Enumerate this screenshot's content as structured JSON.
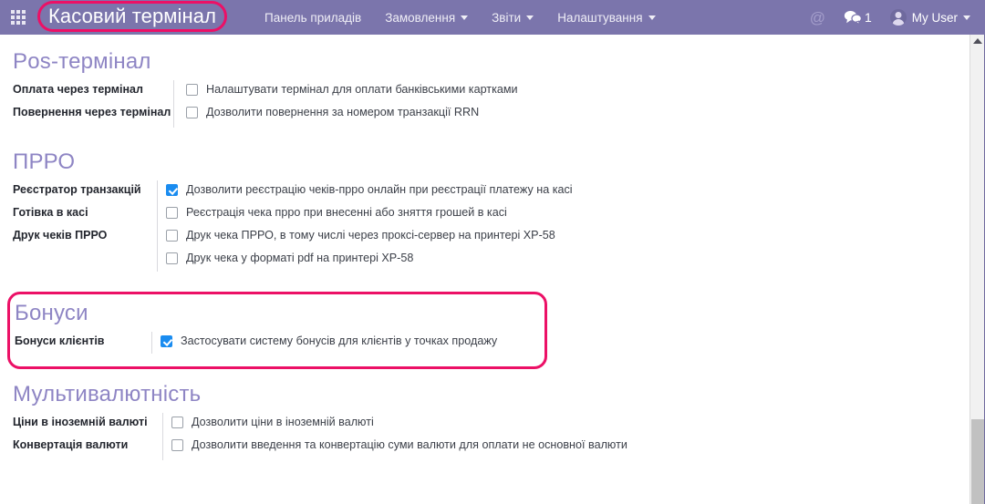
{
  "topbar": {
    "apps_icon": "apps-grid-icon",
    "brand_title": "Касовий термінал",
    "nav_items": [
      {
        "label": "Панель приладів",
        "has_caret": false
      },
      {
        "label": "Замовлення",
        "has_caret": true
      },
      {
        "label": "Звіти",
        "has_caret": true
      },
      {
        "label": "Налаштування",
        "has_caret": true
      }
    ],
    "mention_icon": "@",
    "chat_icon": "chat-bubbles-icon",
    "chat_count": "1",
    "avatar_icon": "user-avatar",
    "username": "My User",
    "user_caret": true
  },
  "highlight_color": "#ec1066",
  "accent_color": "#8e85c4",
  "header_color": "#7b75ac",
  "checkbox_on_color": "#1a8cf0",
  "sections": [
    {
      "id": "pos",
      "title": "Pos-термінал",
      "rows": [
        {
          "label": "Оплата через термінал",
          "checkbox_text": "Налаштувати термінал для оплати банківськими картками",
          "checked": false
        },
        {
          "label": "Повернення через термінал",
          "checkbox_text": "Дозволити повернення за номером транзакції RRN",
          "checked": false
        }
      ]
    },
    {
      "id": "prro",
      "title": "ПРРО",
      "rows": [
        {
          "label": "Реєстратор транзакцій",
          "checkbox_text": "Дозволити реєстрацію чеків-прро онлайн при реєстрації платежу на касі",
          "checked": true
        },
        {
          "label": "Готівка в касі",
          "checkbox_text": "Реєстрація чека прро при внесенні або зняття грошей в касі",
          "checked": false
        },
        {
          "label": "Друк чеків ПРРО",
          "checkbox_text": "Друк чека ПРРО, в тому числі через проксі-сервер на принтері XP-58",
          "checked": false
        },
        {
          "label": "",
          "checkbox_text": "Друк чека у форматі pdf на принтері XP-58",
          "checked": false
        }
      ]
    },
    {
      "id": "bonus",
      "title": "Бонуси",
      "highlighted": true,
      "rows": [
        {
          "label": "Бонуси клієнтів",
          "checkbox_text": "Застосувати систему бонусів для клієнтів у точках продажу",
          "checked": true
        }
      ]
    },
    {
      "id": "multi",
      "title": "Мультивалютність",
      "rows": [
        {
          "label": "Ціни в іноземній валюті",
          "checkbox_text": "Дозволити ціни в іноземній валюті",
          "checked": false
        },
        {
          "label": "Конвертація валюти",
          "checkbox_text": "Дозволити введення та конвертацію суми валюти для оплати не основної валюти",
          "checked": false
        }
      ]
    }
  ],
  "scrollbar": {
    "up_arrow": "scroll-up-arrow",
    "thumb": "scroll-thumb"
  }
}
